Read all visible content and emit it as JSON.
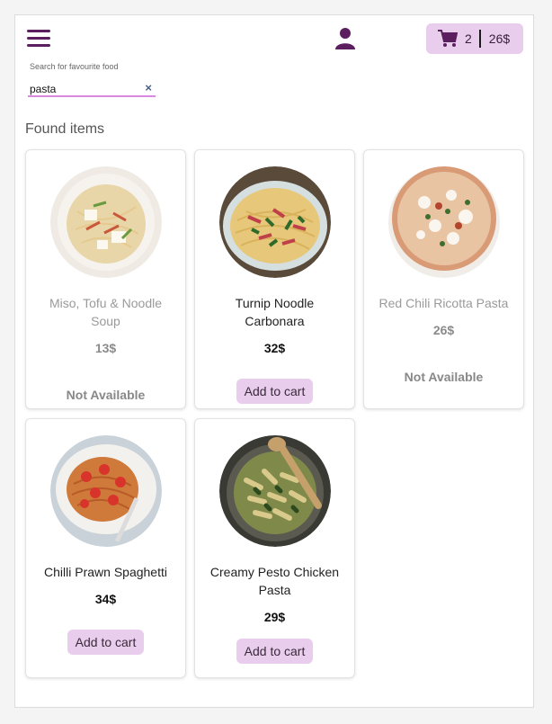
{
  "header": {
    "menu_icon": "hamburger-icon",
    "user_icon": "user-icon",
    "cart": {
      "icon": "cart-icon",
      "count": "2",
      "total": "26$"
    }
  },
  "search": {
    "label": "Search for favourite food",
    "value": "pasta",
    "clear_icon": "×"
  },
  "results": {
    "title": "Found items",
    "items": [
      {
        "name": "Miso, Tofu & Noodle Soup",
        "price": "13$",
        "status": "Not Available"
      },
      {
        "name": "Turnip Noodle Carbonara",
        "price": "32$",
        "action": "Add to cart"
      },
      {
        "name": "Red Chili Ricotta Pasta",
        "price": "26$",
        "status": "Not Available"
      },
      {
        "name": "Chilli Prawn Spaghetti",
        "price": "34$",
        "action": "Add to cart"
      },
      {
        "name": "Creamy Pesto Chicken Pasta",
        "price": "29$",
        "action": "Add to cart"
      }
    ]
  },
  "colors": {
    "accent": "#e8cdec",
    "brand": "#5b1f5f",
    "search_underline": "#d888e0"
  }
}
